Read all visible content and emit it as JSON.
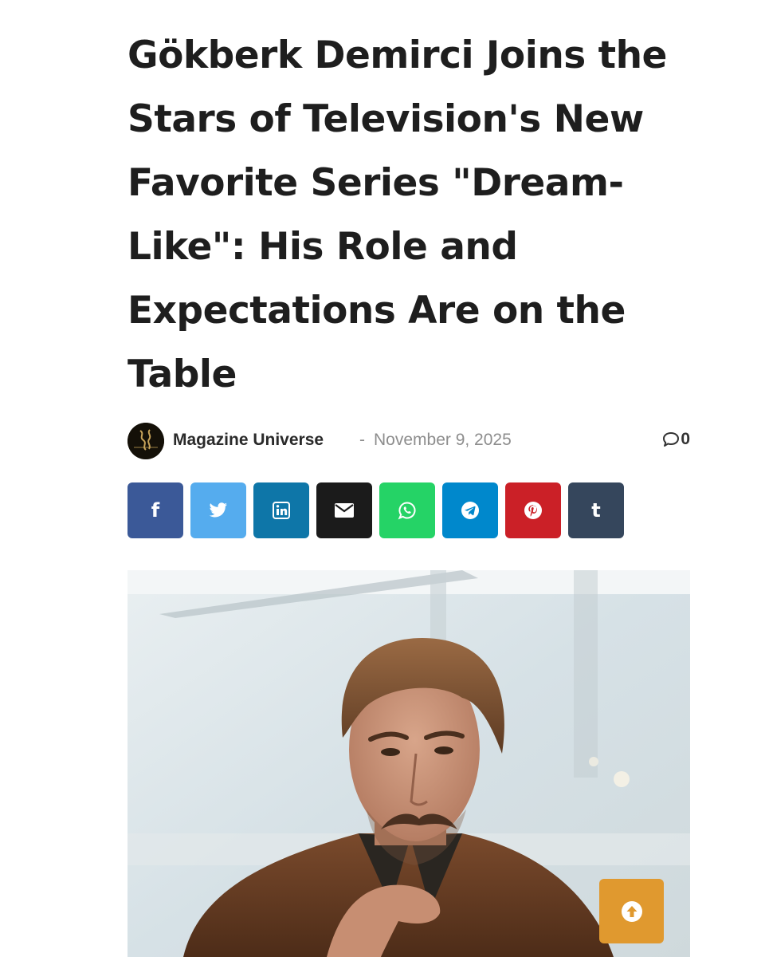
{
  "article": {
    "title": "Gökberk Demirci Joins the Stars of Television's New Favorite Series \"Dream-Like\": His Role and Expectations Are on the Table",
    "author": "Magazine Universe",
    "separator": "-",
    "date": "November 9, 2025",
    "comment_count": "0",
    "avatar_logo_text": "MAGAZIN EVRENI"
  },
  "share_buttons": [
    {
      "name": "facebook",
      "icon": "facebook-icon",
      "color": "#3b5998"
    },
    {
      "name": "twitter",
      "icon": "twitter-icon",
      "color": "#55acee"
    },
    {
      "name": "linkedin",
      "icon": "linkedin-icon",
      "color": "#0e76a8"
    },
    {
      "name": "email",
      "icon": "envelope-icon",
      "color": "#1b1b1b"
    },
    {
      "name": "whatsapp",
      "icon": "whatsapp-icon",
      "color": "#25d366"
    },
    {
      "name": "telegram",
      "icon": "telegram-icon",
      "color": "#0088cc"
    },
    {
      "name": "pinterest",
      "icon": "pinterest-icon",
      "color": "#cb2027"
    },
    {
      "name": "tumblr",
      "icon": "tumblr-icon",
      "color": "#35465c"
    }
  ],
  "scroll_top": {
    "icon": "arrow-up-circle-icon",
    "color": "#e0992f"
  }
}
